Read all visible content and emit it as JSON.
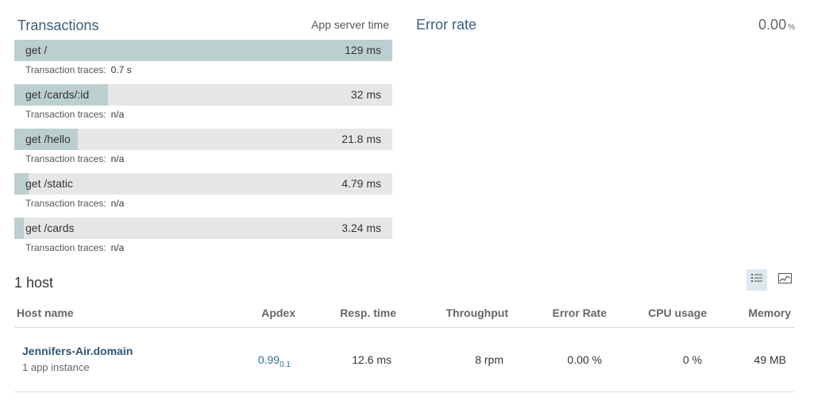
{
  "transactions": {
    "title": "Transactions",
    "column_label": "App server time",
    "traces_label": "Transaction traces:",
    "items": [
      {
        "name": "get /",
        "time": "129 ms",
        "fill_fraction": 1.0,
        "traces": "0.7 s"
      },
      {
        "name": "get /cards/:id",
        "time": "32 ms",
        "fill_fraction": 0.248,
        "traces": "n/a"
      },
      {
        "name": "get /hello",
        "time": "21.8 ms",
        "fill_fraction": 0.169,
        "traces": "n/a"
      },
      {
        "name": "get /static",
        "time": "4.79 ms",
        "fill_fraction": 0.037,
        "traces": "n/a"
      },
      {
        "name": "get /cards",
        "time": "3.24 ms",
        "fill_fraction": 0.025,
        "traces": "n/a"
      }
    ]
  },
  "error_rate": {
    "title": "Error rate",
    "value": "0.00",
    "unit": "%"
  },
  "hosts": {
    "title": "1 host",
    "columns": {
      "host_name": "Host name",
      "apdex": "Apdex",
      "resp_time": "Resp. time",
      "throughput": "Throughput",
      "error_rate": "Error Rate",
      "cpu_usage": "CPU usage",
      "memory": "Memory"
    },
    "rows": [
      {
        "name": "Jennifers-Air.domain",
        "instances": "1 app instance",
        "apdex": "0.99",
        "apdex_t": "0.1",
        "resp_time": "12.6 ms",
        "throughput": "8 rpm",
        "error_rate": "0.00 %",
        "cpu_usage": "0 %",
        "memory": "49 MB"
      }
    ]
  },
  "colors": {
    "accent_title": "#3b5f7d",
    "bar_track": "#e6e6e6",
    "bar_fill": "#bccfcf",
    "link": "#2e5673"
  },
  "icons": {
    "list_view": "list-view-icon",
    "chart_view": "chart-view-icon"
  }
}
